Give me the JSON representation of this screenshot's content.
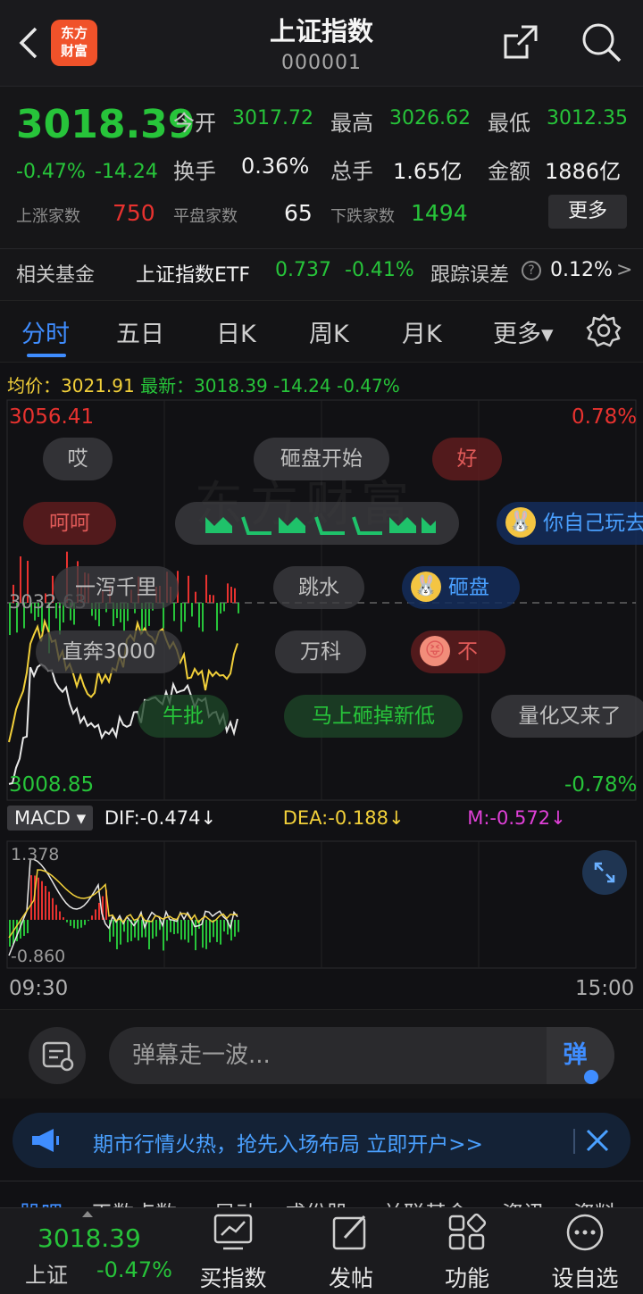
{
  "header": {
    "title": "上证指数",
    "code": "000001",
    "logo_text_line1": "东方",
    "logo_text_line2": "财富"
  },
  "quote": {
    "price": "3018.39",
    "change_pct": "-0.47%",
    "change": "-14.24",
    "open_label": "今开",
    "open": "3017.72",
    "high_label": "最高",
    "high": "3026.62",
    "low_label": "最低",
    "low": "3012.35",
    "turnover_label": "换手",
    "turnover": "0.36%",
    "volume_label": "总手",
    "volume": "1.65亿",
    "amount_label": "金额",
    "amount": "1886亿",
    "up_label": "上涨家数",
    "up_count": "750",
    "flat_label": "平盘家数",
    "flat_count": "65",
    "down_label": "下跌家数",
    "down_count": "1494",
    "more_label": "更多"
  },
  "fund": {
    "label": "相关基金",
    "name": "上证指数ETF",
    "price": "0.737",
    "change_pct": "-0.41%",
    "tracking_label": "跟踪误差",
    "tracking_value": "0.12%",
    "arrow": ">"
  },
  "tabs": [
    "分时",
    "五日",
    "日K",
    "周K",
    "月K",
    "更多▾"
  ],
  "chart": {
    "avg_label": "均价：",
    "avg_value": "3021.91",
    "latest_label": "最新：",
    "latest_value": "3018.39",
    "latest_change": "-14.24",
    "latest_pct": "-0.47%",
    "y_max": "3056.41",
    "y_min": "3008.85",
    "pct_max": "0.78%",
    "pct_min": "-0.78%",
    "prev_close_label": "3032.63",
    "time_start": "09:30",
    "time_end": "15:00",
    "watermark": "东方财富"
  },
  "danmu": [
    {
      "text": "哎"
    },
    {
      "text": "砸盘开始"
    },
    {
      "text": "好"
    },
    {
      "text": "呵呵"
    },
    {
      "text": "你自己玩去"
    },
    {
      "text": "一泻千里"
    },
    {
      "text": "跳水"
    },
    {
      "text": "砸盘"
    },
    {
      "text": "直奔3000"
    },
    {
      "text": "万科"
    },
    {
      "text": "不"
    },
    {
      "text": "牛批"
    },
    {
      "text": "马上砸掉新低"
    },
    {
      "text": "量化又来了"
    }
  ],
  "macd": {
    "button": "MACD ▾",
    "dif": "DIF:-0.474↓",
    "dea": "DEA:-0.188↓",
    "m": "M:-0.572↓",
    "y_max": "1.378",
    "y_min": "-0.860"
  },
  "comment": {
    "placeholder": "弹幕走一波...",
    "send_label": "弹"
  },
  "banner": {
    "text": "期市行情火热，抢先入场布局 立即开户>>"
  },
  "info_tabs": [
    "股吧",
    "天数点数",
    "异动",
    "成份股",
    "关联基金",
    "资讯",
    "资料"
  ],
  "bottom_bar": {
    "price": "3018.39",
    "name": "上证",
    "pct": "-0.47%",
    "items": [
      "买指数",
      "发帖",
      "功能",
      "设自选"
    ]
  },
  "colors": {
    "up": "#e8322f",
    "down": "#27c43a",
    "accent": "#3f8dff",
    "avg_line": "#f2d03a"
  }
}
